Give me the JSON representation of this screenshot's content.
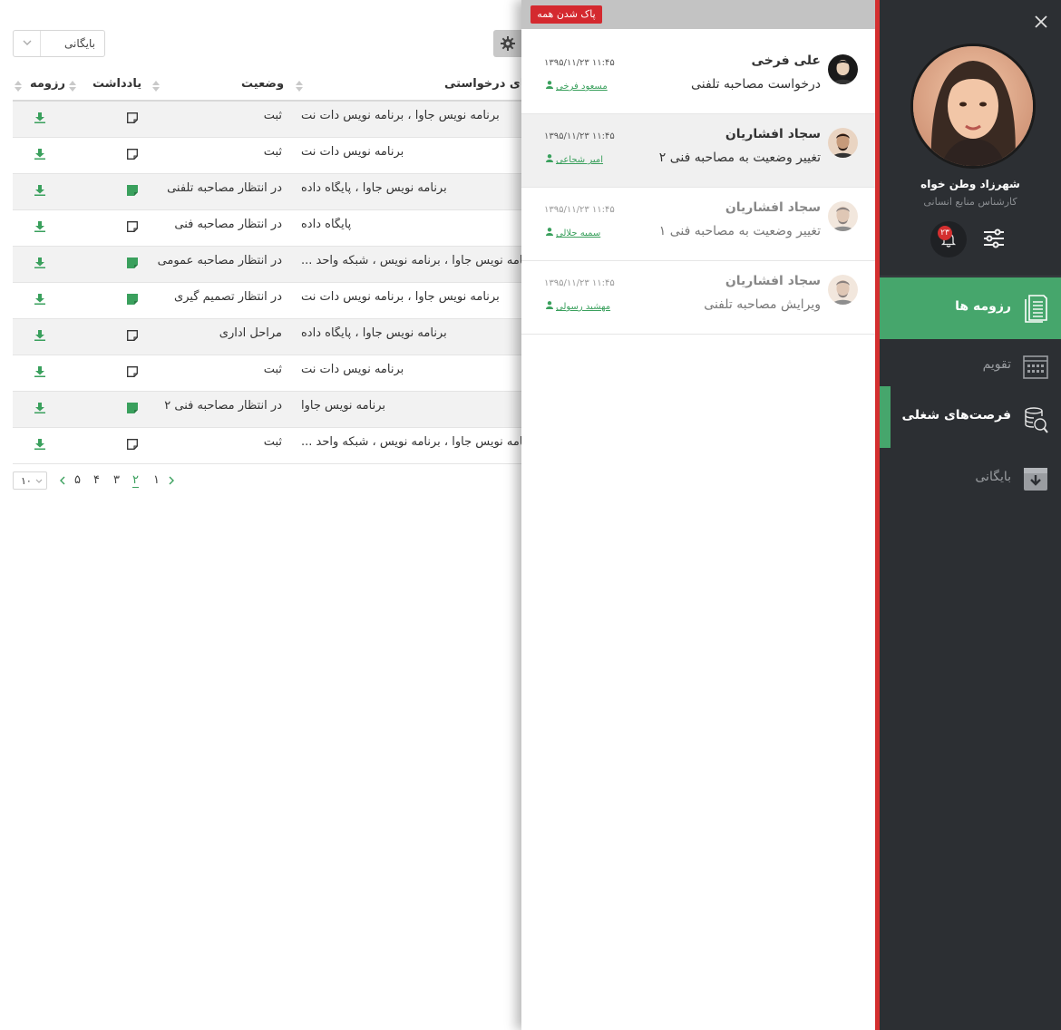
{
  "toolbar": {
    "archive_select": "بایگانی"
  },
  "table": {
    "headers": {
      "resume": "رزومه",
      "note": "یادداشت",
      "status": "وضعیت",
      "jobs": "فرصت‌های درخواستی"
    },
    "rows": [
      {
        "status": "ثبت",
        "jobs": "برنامه نویس جاوا ، برنامه نویس دات نت",
        "note_filled": false
      },
      {
        "status": "ثبت",
        "jobs": "برنامه نویس دات نت",
        "note_filled": false
      },
      {
        "status": "در انتظار مصاحبه تلفنی",
        "jobs": "برنامه نویس جاوا ، پایگاه داده",
        "note_filled": true
      },
      {
        "status": "در انتظار مصاحبه فنی",
        "jobs": "پایگاه داده",
        "note_filled": false
      },
      {
        "status": "در انتظار مصاحبه عمومی",
        "jobs": "برنامه نویس جاوا ، برنامه نویس ، شبکه واحد ...",
        "note_filled": true
      },
      {
        "status": "در انتظار تصمیم گیری",
        "jobs": "برنامه نویس جاوا ، برنامه نویس دات نت",
        "note_filled": true
      },
      {
        "status": "مراحل اداری",
        "jobs": "برنامه نویس جاوا ، پایگاه داده",
        "note_filled": false
      },
      {
        "status": "ثبت",
        "jobs": "برنامه نویس دات نت",
        "note_filled": false
      },
      {
        "status": "در انتظار مصاحبه فنی ۲",
        "jobs": "برنامه نویس جاوا",
        "note_filled": true
      },
      {
        "status": "ثبت",
        "jobs": "برنامه نویس جاوا ، برنامه نویس ، شبکه واحد ...",
        "note_filled": false
      }
    ]
  },
  "pager": {
    "page_size": "۱۰",
    "pages": [
      "۵",
      "۴",
      "۳",
      "۲",
      "۱"
    ],
    "current": "۲"
  },
  "notifications": {
    "clear_all": "پاک شدن همه",
    "items": [
      {
        "name": "علی فرخی",
        "action": "درخواست مصاحبه تلفنی",
        "time": "۱۳۹۵/۱۱/۲۳ ۱۱:۴۵",
        "who": "مسعود فرخی",
        "state": "unread"
      },
      {
        "name": "سجاد افشاریان",
        "action": "تغییر وضعیت به مصاحبه فنی ۲",
        "time": "۱۳۹۵/۱۱/۲۳ ۱۱:۴۵",
        "who": "امیر شجاعی",
        "state": "highlighted"
      },
      {
        "name": "سجاد افشاریان",
        "action": "تغییر وضعیت به مصاحبه فنی ۱",
        "time": "۱۳۹۵/۱۱/۲۳ ۱۱:۴۵",
        "who": "سمیه جلالی",
        "state": "read"
      },
      {
        "name": "سجاد افشاریان",
        "action": "ویرایش مصاحبه تلفنی",
        "time": "۱۳۹۵/۱۱/۲۳ ۱۱:۴۵",
        "who": "مهشید رسولی",
        "state": "read"
      }
    ]
  },
  "sidebar": {
    "user_name": "شهرزاد  وطن خواه",
    "user_role": "کارشناس منابع انسانی",
    "notification_count": "۲۳",
    "nav": [
      {
        "label": "رزومه ها",
        "icon": "resume-icon",
        "state": "active"
      },
      {
        "label": "تقویم",
        "icon": "calendar-icon",
        "state": "normal"
      },
      {
        "label": "فرصت‌های شغلی",
        "icon": "job-search-icon",
        "state": "selected"
      },
      {
        "label": "بایگانی",
        "icon": "archive-icon",
        "state": "normal"
      }
    ]
  },
  "colors": {
    "accent": "#46a66c",
    "danger": "#d42f2f",
    "sidebar_bg": "#2c2f33"
  }
}
